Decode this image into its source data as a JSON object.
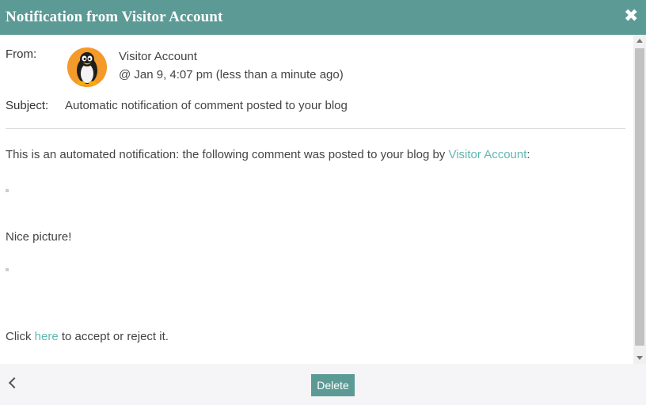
{
  "dialog": {
    "title": "Notification from Visitor Account",
    "close_icon": "close-icon"
  },
  "header": {
    "from_label": "From:",
    "sender_name": "Visitor Account",
    "sent_time": "@ Jan 9, 4:07 pm (less than a minute ago)",
    "avatar_icon": "penguin-avatar",
    "subject_label": "Subject:",
    "subject": "Automatic notification of comment posted to your blog"
  },
  "body": {
    "intro_text": "This is an automated notification: the following comment was posted to your blog by ",
    "intro_link": "Visitor Account",
    "intro_suffix": ":",
    "comment": "Nice picture!",
    "cta_prefix": "Click ",
    "cta_link": "here",
    "cta_suffix": " to accept or reject it."
  },
  "footer": {
    "back_icon": "chevron-left-icon",
    "delete_label": "Delete"
  },
  "colors": {
    "accent": "#5c9b95",
    "link": "#5fb8b0"
  }
}
